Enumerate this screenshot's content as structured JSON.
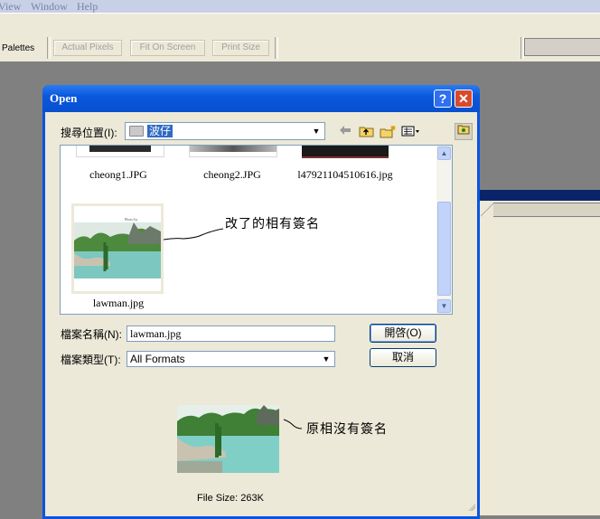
{
  "menu": [
    "View",
    "Window",
    "Help"
  ],
  "toolbar": {
    "palettes_label": "Palettes",
    "buttons": [
      "Actual Pixels",
      "Fit On Screen",
      "Print Size"
    ]
  },
  "dialog": {
    "title": "Open",
    "help_glyph": "?",
    "close_glyph": "✕",
    "look_in_label": "搜尋位置(I):",
    "look_in_value": "波仔",
    "files": [
      {
        "name": "cheong1.JPG"
      },
      {
        "name": "cheong2.JPG"
      },
      {
        "name": "l47921104510616.jpg"
      },
      {
        "name": "lawman.jpg"
      }
    ],
    "annotation_list": "改了的相有簽名",
    "file_name_label": "檔案名稱(N):",
    "file_name_value": "lawman.jpg",
    "file_type_label": "檔案類型(T):",
    "file_type_value": "All Formats",
    "open_button": "開啓(O)",
    "cancel_button": "取消",
    "annotation_preview": "原相沒有簽名",
    "file_size": "File Size:  263K"
  },
  "icons": {
    "back": "back-arrow-icon",
    "up": "up-folder-icon",
    "new_folder": "new-folder-icon",
    "views": "views-menu-icon",
    "places": "places-icon"
  },
  "colors": {
    "titlebar": "#0a58dc",
    "dialog_bg": "#ece9d8",
    "selection": "#316ac5"
  }
}
